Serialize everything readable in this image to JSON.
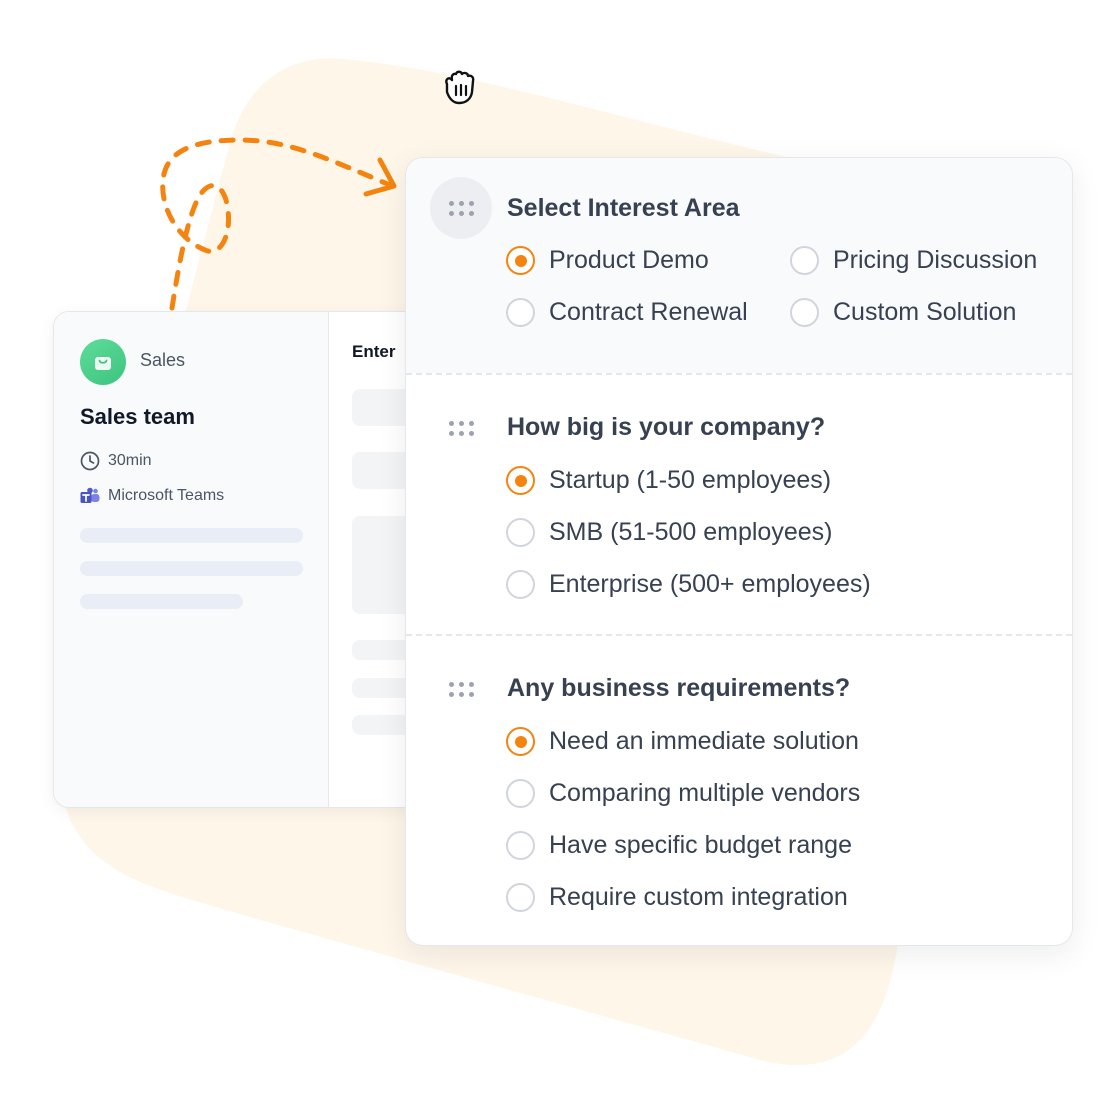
{
  "colors": {
    "accent": "#f4840f",
    "blob": "#fff6ea",
    "badge_green": "#3cc47e",
    "teams_purple": "#5059c9"
  },
  "back_card": {
    "app_icon": "shopping-bag-icon",
    "app_name": "Sales",
    "team_title": "Sales team",
    "duration": "30min",
    "duration_icon": "clock-icon",
    "platform": "Microsoft Teams",
    "platform_icon": "microsoft-teams-icon",
    "right_heading": "Enter"
  },
  "form": {
    "questions": [
      {
        "title": "Select Interest Area",
        "options": [
          "Product Demo",
          "Pricing Discussion",
          "Contract Renewal",
          "Custom Solution"
        ],
        "selected": "Product Demo"
      },
      {
        "title": "How big is your company?",
        "options": [
          "Startup (1-50 employees)",
          "SMB (51-500 employees)",
          "Enterprise (500+ employees)"
        ],
        "selected": "Startup (1-50 employees)"
      },
      {
        "title": "Any business requirements?",
        "options": [
          "Need an immediate solution",
          "Comparing multiple vendors",
          "Have specific budget range",
          "Require custom integration"
        ],
        "selected": "Need an immediate solution"
      }
    ]
  },
  "cursor_icon": "grab-hand-icon",
  "drag_handle_icon": "drag-dots-icon"
}
